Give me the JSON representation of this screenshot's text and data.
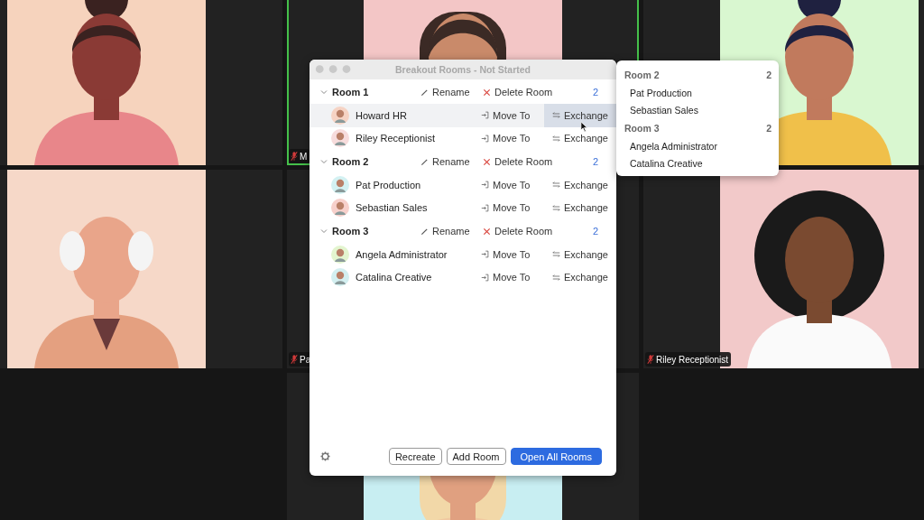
{
  "window": {
    "title": "Breakout Rooms - Not Started"
  },
  "video_tiles": [
    {
      "kind": "picture",
      "active": false
    },
    {
      "kind": "picture",
      "active": true,
      "label": {
        "text": "M",
        "muted": true
      }
    },
    {
      "kind": "picture",
      "active": false
    },
    {
      "kind": "picture",
      "active": false
    },
    {
      "kind": "empty",
      "active": false,
      "label": {
        "text": "Pa",
        "muted": true
      }
    },
    {
      "kind": "picture",
      "active": false,
      "label": {
        "text": "Riley Receptionist",
        "muted": true
      }
    },
    {
      "kind": "picture",
      "active": false
    }
  ],
  "rooms": [
    {
      "name": "Room 1",
      "expanded": true,
      "rename": "Rename",
      "delete": "Delete Room",
      "count": "2",
      "participants": [
        {
          "name": "Howard HR",
          "color": "#f6d3c4",
          "move": "Move To",
          "exchange": "Exchange",
          "hovered": true
        },
        {
          "name": "Riley Receptionist",
          "color": "#f7dcdc",
          "move": "Move To",
          "exchange": "Exchange",
          "hovered": false
        }
      ]
    },
    {
      "name": "Room 2",
      "expanded": true,
      "rename": "Rename",
      "delete": "Delete Room",
      "count": "2",
      "participants": [
        {
          "name": "Pat Production",
          "color": "#d3f1f2",
          "move": "Move To",
          "exchange": "Exchange",
          "hovered": false
        },
        {
          "name": "Sebastian Sales",
          "color": "#f7d0cb",
          "move": "Move To",
          "exchange": "Exchange",
          "hovered": false
        }
      ]
    },
    {
      "name": "Room 3",
      "expanded": true,
      "rename": "Rename",
      "delete": "Delete Room",
      "count": "2",
      "participants": [
        {
          "name": "Angela Administrator",
          "color": "#e3f5cf",
          "move": "Move To",
          "exchange": "Exchange",
          "hovered": false
        },
        {
          "name": "Catalina Creative",
          "color": "#d3eff0",
          "move": "Move To",
          "exchange": "Exchange",
          "hovered": false
        }
      ]
    }
  ],
  "exchange_menu": {
    "rooms": [
      {
        "name": "Room 2",
        "count": "2",
        "participants": [
          "Pat Production",
          "Sebastian Sales"
        ]
      },
      {
        "name": "Room 3",
        "count": "2",
        "participants": [
          "Angela Administrator",
          "Catalina Creative"
        ]
      }
    ]
  },
  "buttons": [
    {
      "label": "Recreate",
      "kind": "secondary"
    },
    {
      "label": "Add Room",
      "kind": "secondary"
    },
    {
      "label": "Open All Rooms",
      "kind": "primary"
    }
  ]
}
